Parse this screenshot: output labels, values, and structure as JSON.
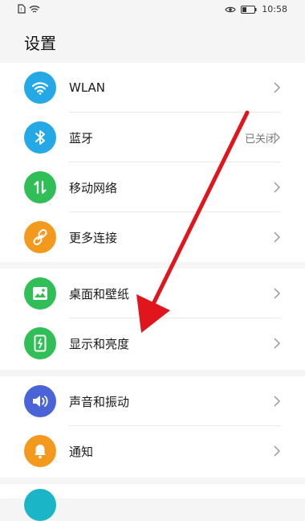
{
  "status_bar": {
    "time": "10:58"
  },
  "page": {
    "title": "设置"
  },
  "colors": {
    "wlan": "#24a8e6",
    "bluetooth": "#24a8e6",
    "mobile": "#2fbf56",
    "more": "#f39a1e",
    "wallpaper": "#2fbf56",
    "display": "#2fbf56",
    "sound": "#4a63d6",
    "notify": "#f39a1e",
    "arrow": "#e0161c"
  },
  "settings": {
    "group1": [
      {
        "label": "WLAN",
        "icon": "wifi-icon"
      },
      {
        "label": "蓝牙",
        "value": "已关闭",
        "icon": "bluetooth-icon"
      },
      {
        "label": "移动网络",
        "icon": "mobile-data-icon"
      },
      {
        "label": "更多连接",
        "icon": "link-icon"
      }
    ],
    "group2": [
      {
        "label": "桌面和壁纸",
        "icon": "image-icon"
      },
      {
        "label": "显示和亮度",
        "icon": "brightness-icon"
      }
    ],
    "group3": [
      {
        "label": "声音和振动",
        "icon": "speaker-icon"
      },
      {
        "label": "通知",
        "icon": "bell-icon"
      }
    ]
  }
}
